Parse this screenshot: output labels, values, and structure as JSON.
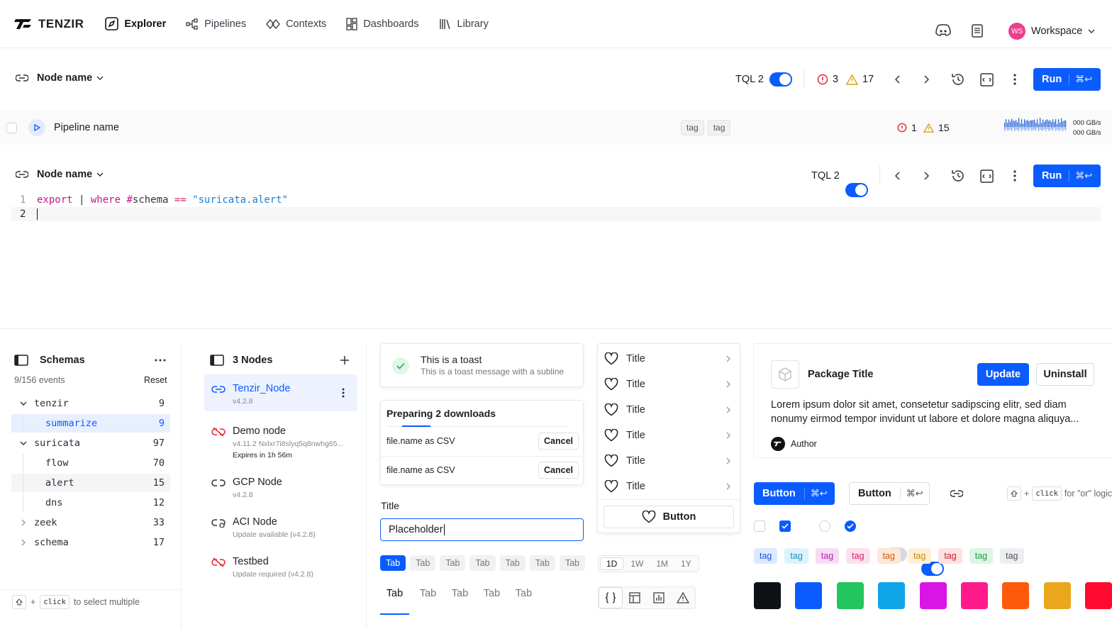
{
  "brand": {
    "name": "TENZIR"
  },
  "nav": [
    {
      "label": "Explorer",
      "icon": "explorer-icon"
    },
    {
      "label": "Pipelines",
      "icon": "pipelines-icon"
    },
    {
      "label": "Contexts",
      "icon": "contexts-icon"
    },
    {
      "label": "Dashboards",
      "icon": "dashboards-icon"
    },
    {
      "label": "Library",
      "icon": "library-icon"
    }
  ],
  "workspace": {
    "initials": "WS",
    "label": "Workspace"
  },
  "bar1": {
    "node": "Node name",
    "tql": "TQL 2",
    "errors": "3",
    "warnings": "17",
    "run": "Run",
    "shortcut": "⌘↩"
  },
  "pipeline": {
    "name": "Pipeline name",
    "tags": [
      "tag",
      "tag"
    ],
    "errors": "1",
    "warnings": "15",
    "rate1": "000 GB/s",
    "rate2": "000 GB/s"
  },
  "bar2": {
    "node": "Node name",
    "tql": "TQL 2",
    "run": "Run",
    "shortcut": "⌘↩"
  },
  "editor": {
    "lines": [
      {
        "num": "1",
        "tokens": [
          {
            "t": "export",
            "c": "#c2188a"
          },
          {
            "t": " | ",
            "c": "#333"
          },
          {
            "t": "where",
            "c": "#c2188a"
          },
          {
            "t": " #",
            "c": "#c2188a"
          },
          {
            "t": "schema",
            "c": "#333"
          },
          {
            "t": " == ",
            "c": "#e3245a"
          },
          {
            "t": "\"suricata.alert\"",
            "c": "#1a7fd0"
          }
        ]
      },
      {
        "num": "2",
        "tokens": []
      }
    ]
  },
  "schemas": {
    "title": "Schemas",
    "events": "9/156 events",
    "reset": "Reset",
    "rows": [
      {
        "name": "tenzir",
        "count": "9",
        "chev": "v",
        "indent": 0
      },
      {
        "name": "summarize",
        "count": "9",
        "indent": 1,
        "selected": true
      },
      {
        "name": "suricata",
        "count": "97",
        "chev": "v",
        "indent": 0
      },
      {
        "name": "flow",
        "count": "70",
        "indent": 1
      },
      {
        "name": "alert",
        "count": "15",
        "indent": 1,
        "hover": true
      },
      {
        "name": "dns",
        "count": "12",
        "indent": 1
      },
      {
        "name": "zeek",
        "count": "33",
        "chev": ">",
        "indent": 0
      },
      {
        "name": "schema",
        "count": "17",
        "chev": ">",
        "indent": 0
      }
    ],
    "hint_key": "click",
    "hint_plus": "+",
    "hint": "to select multiple"
  },
  "nodes": {
    "title": "3 Nodes",
    "items": [
      {
        "name": "Tenzir_Node",
        "sub": "v4.2.8",
        "status": "connected"
      },
      {
        "name": "Demo node",
        "sub": "v4.11.2 Nxlxr7i8slyq5q8nwhg65...",
        "sub2": "Expires in 1h 56m",
        "status": "broken"
      },
      {
        "name": "GCP Node",
        "sub": "v4.2.8",
        "status": "link"
      },
      {
        "name": "ACI Node",
        "sub": "Update available (v4.2.8)",
        "status": "update"
      },
      {
        "name": "Testbed",
        "sub": "Update required (v4.2.8)",
        "status": "broken"
      }
    ]
  },
  "toast": {
    "title": "This is a toast",
    "sub": "This is a toast message with a subline"
  },
  "downloads": {
    "title": "Preparing 2 downloads",
    "items": [
      {
        "label": "file.name as CSV",
        "action": "Cancel"
      },
      {
        "label": "file.name as CSV",
        "action": "Cancel"
      }
    ]
  },
  "field": {
    "label": "Title",
    "value": "Placeholder"
  },
  "tabs_pill": [
    "Tab",
    "Tab",
    "Tab",
    "Tab",
    "Tab",
    "Tab",
    "Tab"
  ],
  "tabs_line": [
    "Tab",
    "Tab",
    "Tab",
    "Tab",
    "Tab"
  ],
  "list": {
    "items": [
      "Title",
      "Title",
      "Title",
      "Title",
      "Title",
      "Title"
    ],
    "button": "Button"
  },
  "ranges": [
    "1D",
    "1W",
    "1M",
    "1Y"
  ],
  "package": {
    "title": "Package Title",
    "update": "Update",
    "uninstall": "Uninstall",
    "desc": "Lorem ipsum dolor sit amet, consetetur sadipscing elitr, sed diam nonumy eirmod tempor invidunt ut labore et dolore magna aliquya...",
    "author": "Author"
  },
  "buttons": {
    "primary": "Button",
    "secondary": "Button",
    "shortcut": "⌘↩",
    "hint_key": "click",
    "hint_plus": "+",
    "hint": "for \"or\" logic"
  },
  "tags": [
    {
      "label": "tag",
      "bg": "#dde9ff",
      "fg": "#1657d8"
    },
    {
      "label": "tag",
      "bg": "#dcf3fc",
      "fg": "#1a8fb8"
    },
    {
      "label": "tag",
      "bg": "#f8dcf6",
      "fg": "#b520a8"
    },
    {
      "label": "tag",
      "bg": "#fde0ee",
      "fg": "#d11d6f"
    },
    {
      "label": "tag",
      "bg": "#fde7d6",
      "fg": "#d05a12"
    },
    {
      "label": "tag",
      "bg": "#fdf0d6",
      "fg": "#c58a10"
    },
    {
      "label": "tag",
      "bg": "#fde0e2",
      "fg": "#d11b2b"
    },
    {
      "label": "tag",
      "bg": "#dcf5e4",
      "fg": "#1f9a4c"
    },
    {
      "label": "tag",
      "bg": "#eceef1",
      "fg": "#555"
    }
  ],
  "swatches": [
    "#0e1116",
    "#0a5cff",
    "#22c55e",
    "#0ea5e9",
    "#d915e6",
    "#ff1a8c",
    "#ff5a0a",
    "#eaa71c",
    "#ff0a2e"
  ],
  "colors": {
    "accent": "#0a5cff",
    "error": "#e5262e",
    "warning": "#d9a31a"
  }
}
